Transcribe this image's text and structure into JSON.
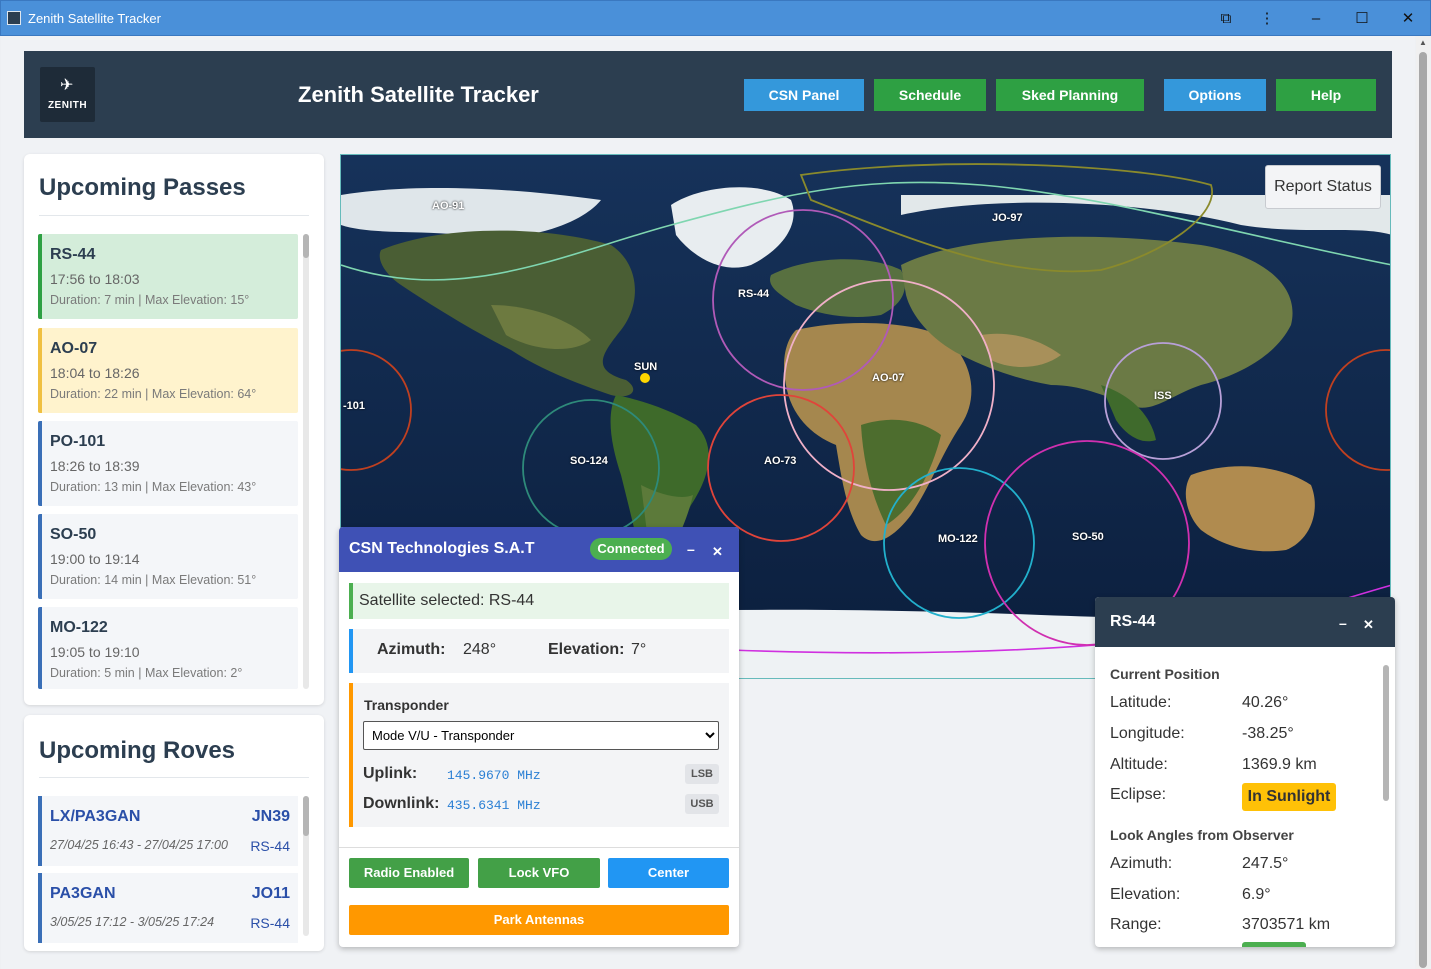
{
  "window": {
    "title": "Zenith Satellite Tracker"
  },
  "header": {
    "logo_text": "ZENITH",
    "title": "Zenith Satellite Tracker",
    "buttons": [
      {
        "label": "CSN Panel",
        "color": "#3498db"
      },
      {
        "label": "Schedule",
        "color": "#2ea043"
      },
      {
        "label": "Sked Planning",
        "color": "#2ea043"
      },
      {
        "label": "Options",
        "color": "#3498db"
      },
      {
        "label": "Help",
        "color": "#2ea043"
      }
    ]
  },
  "passes": {
    "title": "Upcoming Passes",
    "items": [
      {
        "name": "RS-44",
        "time": "17:56 to 18:03",
        "details": "Duration: 7 min | Max Elevation: 15°",
        "state": "active"
      },
      {
        "name": "AO-07",
        "time": "18:04 to 18:26",
        "details": "Duration: 22 min | Max Elevation: 64°",
        "state": "next"
      },
      {
        "name": "PO-101",
        "time": "18:26 to 18:39",
        "details": "Duration: 13 min | Max Elevation: 43°",
        "state": "normal"
      },
      {
        "name": "SO-50",
        "time": "19:00 to 19:14",
        "details": "Duration: 14 min | Max Elevation: 51°",
        "state": "normal"
      },
      {
        "name": "MO-122",
        "time": "19:05 to 19:10",
        "details": "Duration: 5 min | Max Elevation: 2°",
        "state": "normal"
      }
    ]
  },
  "roves": {
    "title": "Upcoming Roves",
    "items": [
      {
        "callsign": "LX/PA3GAN",
        "grid": "JN39",
        "time": "27/04/25 16:43 - 27/04/25 17:00",
        "sat": "RS-44"
      },
      {
        "callsign": "PA3GAN",
        "grid": "JO11",
        "time": "3/05/25 17:12 - 3/05/25 17:24",
        "sat": "RS-44"
      }
    ]
  },
  "map": {
    "report_button": "Report Status",
    "labels": {
      "ao91": "AO-91",
      "jo97": "JO-97",
      "rs44": "RS-44",
      "sun": "SUN",
      "ao07": "AO-07",
      "po101": "-101",
      "iss": "ISS",
      "so124": "SO-124",
      "ao73": "AO-73",
      "mo122": "MO-122",
      "so50": "SO-50"
    }
  },
  "csn": {
    "title": "CSN Technologies S.A.T",
    "status": "Connected",
    "minimize": "–",
    "close": "✕",
    "selected": "Satellite selected: RS-44",
    "azimuth_label": "Azimuth:",
    "azimuth_value": "248°",
    "elevation_label": "Elevation:",
    "elevation_value": "7°",
    "transponder_label": "Transponder",
    "transponder_value": "Mode V/U - Transponder",
    "uplink_label": "Uplink:",
    "uplink_value": "145.9670 MHz",
    "uplink_mode": "LSB",
    "downlink_label": "Downlink:",
    "downlink_value": "435.6341 MHz",
    "downlink_mode": "USB",
    "buttons": {
      "radio": "Radio Enabled",
      "lock": "Lock VFO",
      "center": "Center",
      "park": "Park Antennas"
    }
  },
  "satinfo": {
    "title": "RS-44",
    "minimize": "–",
    "close": "✕",
    "current_position": "Current Position",
    "latitude_label": "Latitude:",
    "latitude": "40.26°",
    "longitude_label": "Longitude:",
    "longitude": "-38.25°",
    "altitude_label": "Altitude:",
    "altitude": "1369.9 km",
    "eclipse_label": "Eclipse:",
    "eclipse": "In Sunlight",
    "look_angles": "Look Angles from Observer",
    "azimuth_label": "Azimuth:",
    "azimuth": "247.5°",
    "elevation_label": "Elevation:",
    "elevation": "6.9°",
    "range_label": "Range:",
    "range": "3703571 km"
  },
  "colors": {
    "accent_blue": "#3498db",
    "green": "#2ea043",
    "header": "#2c3e50",
    "csn_header": "#3f51b5",
    "orange": "#ff9800"
  },
  "icons": {
    "satellite": "satellite-icon",
    "extension": "puzzle-icon",
    "more": "kebab-icon",
    "minimize": "minimize-icon",
    "maximize": "maximize-icon",
    "close": "close-icon"
  }
}
